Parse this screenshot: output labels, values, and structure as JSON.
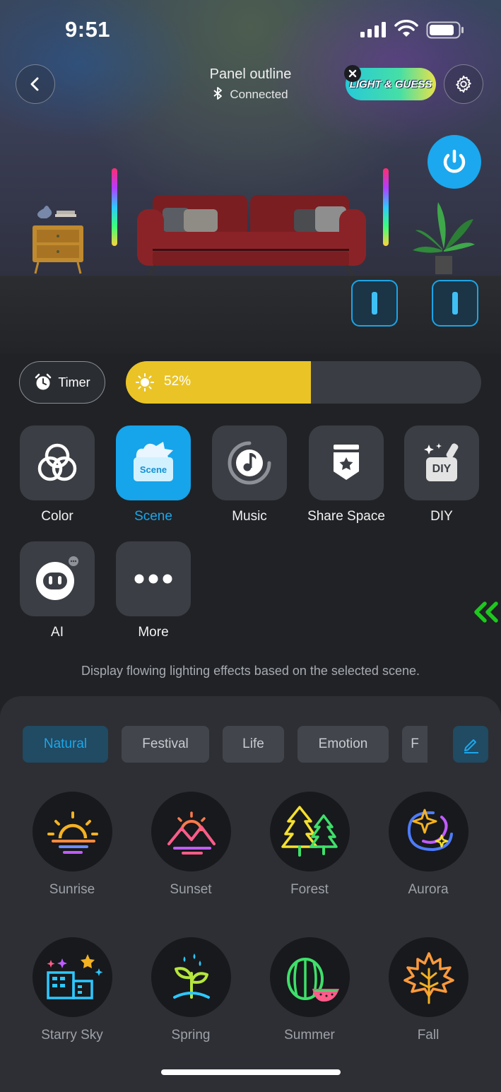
{
  "status_bar": {
    "time": "9:51"
  },
  "header": {
    "title": "Panel outline",
    "connection": "Connected",
    "promo_label": "LIGHT & GUESS"
  },
  "controls": {
    "timer_label": "Timer",
    "brightness_percent": 52,
    "brightness_label": "52%"
  },
  "modes": [
    {
      "label": "Color",
      "icon": "color-circles-icon",
      "active": false
    },
    {
      "label": "Scene",
      "icon": "scene-icon",
      "active": true
    },
    {
      "label": "Music",
      "icon": "music-icon",
      "active": false
    },
    {
      "label": "Share Space",
      "icon": "share-space-icon",
      "active": false
    },
    {
      "label": "DIY",
      "icon": "diy-icon",
      "active": false
    },
    {
      "label": "AI",
      "icon": "ai-robot-icon",
      "active": false
    },
    {
      "label": "More",
      "icon": "more-dots-icon",
      "active": false
    }
  ],
  "scene_icon_text": "Scene",
  "diy_icon_text": "DIY",
  "description": "Display flowing lighting effects based on the selected scene.",
  "scene_tabs": [
    {
      "label": "Natural",
      "active": true
    },
    {
      "label": "Festival",
      "active": false
    },
    {
      "label": "Life",
      "active": false
    },
    {
      "label": "Emotion",
      "active": false
    },
    {
      "label": "F",
      "active": false
    }
  ],
  "scenes": [
    {
      "label": "Sunrise",
      "icon": "sunrise-icon"
    },
    {
      "label": "Sunset",
      "icon": "sunset-icon"
    },
    {
      "label": "Forest",
      "icon": "forest-icon"
    },
    {
      "label": "Aurora",
      "icon": "aurora-icon"
    },
    {
      "label": "Starry Sky",
      "icon": "starry-sky-icon"
    },
    {
      "label": "Spring",
      "icon": "spring-icon"
    },
    {
      "label": "Summer",
      "icon": "summer-icon"
    },
    {
      "label": "Fall",
      "icon": "fall-icon"
    }
  ],
  "colors": {
    "accent": "#1ba8ee",
    "brightness": "#eac426",
    "background": "#202226",
    "collapse_arrow": "#1ec81e"
  }
}
